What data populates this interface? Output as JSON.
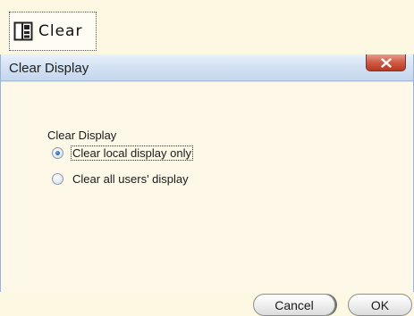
{
  "toolbar": {
    "clear_button": {
      "label": "Clear",
      "icon": "clear-display-icon"
    }
  },
  "dialog": {
    "title": "Clear Display",
    "close_icon": "close-icon",
    "group_label": "Clear Display",
    "options": [
      {
        "label": "Clear local display only",
        "checked": true
      },
      {
        "label": "Clear all users' display",
        "checked": false
      }
    ],
    "buttons": {
      "cancel": "Cancel",
      "ok": "OK"
    }
  },
  "colors": {
    "background": "#fdf8e7",
    "titlebar": "#d4e2f3",
    "close_button": "#cf5a44",
    "radio_selected": "#2c6bbd"
  }
}
